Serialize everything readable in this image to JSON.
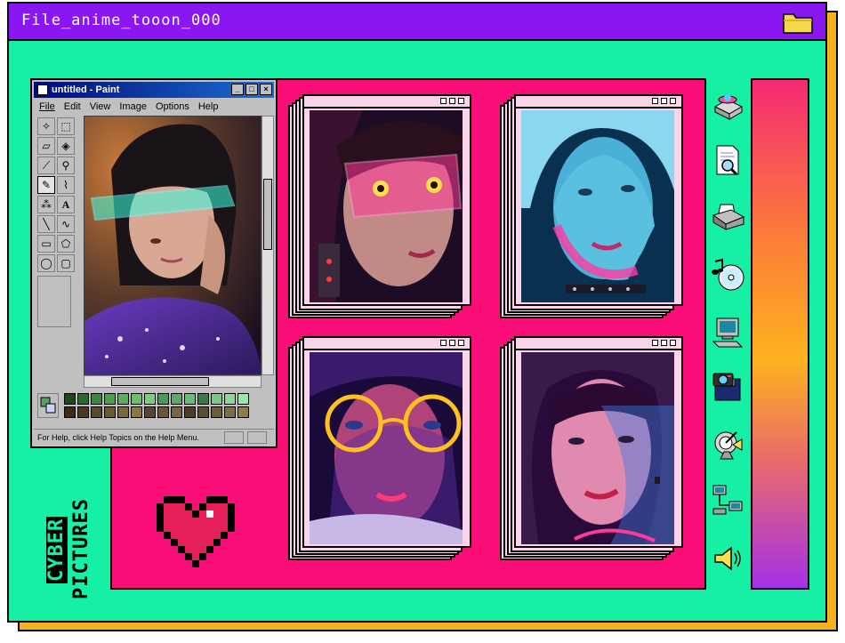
{
  "window": {
    "title": "File_anime_tooon_000",
    "folder_icon": "folder-icon"
  },
  "paint": {
    "title": "untitled - Paint",
    "min_label": "_",
    "max_label": "□",
    "close_label": "×",
    "menu": [
      "File",
      "Edit",
      "View",
      "Image",
      "Options",
      "Help"
    ],
    "tool_icons": [
      "free-select-icon",
      "rect-select-icon",
      "eraser-icon",
      "fill-icon",
      "eyedropper-icon",
      "magnifier-icon",
      "pencil-icon",
      "brush-icon",
      "airbrush-icon",
      "text-icon",
      "line-icon",
      "curve-icon",
      "rectangle-icon",
      "polygon-icon",
      "ellipse-icon",
      "rounded-rect-icon"
    ],
    "text_tool_label": "A",
    "status": "For Help, click Help Topics on the Help Menu.",
    "palette_row1": [
      "#1a4a1a",
      "#2a6a2a",
      "#3a8a3a",
      "#4aa04a",
      "#5ab05a",
      "#6ac06a",
      "#7ad07a",
      "#4a9a5a",
      "#5aaa6a",
      "#6aba7a",
      "#3a7a4a",
      "#7ac88a",
      "#8ad89a",
      "#9ae8aa"
    ],
    "palette_row2": [
      "#3a2a1a",
      "#4a3a22",
      "#5a4a2a",
      "#6a5a32",
      "#7a6a3a",
      "#8a7a42",
      "#5a4630",
      "#6a5638",
      "#7a6640",
      "#4a3e2a",
      "#5a4e32",
      "#6a5e3a",
      "#7a6e42",
      "#8a7e4a"
    ]
  },
  "photos": [
    {
      "name": "photo-cyber-visor-girl",
      "colors": [
        "#2a0a2a",
        "#ff2a8a",
        "#7a2a5a"
      ]
    },
    {
      "name": "photo-blue-hair-girl",
      "colors": [
        "#0a2a4a",
        "#3ad0ff",
        "#ff3aa0"
      ]
    },
    {
      "name": "photo-neon-glasses-girl",
      "colors": [
        "#1a0a3a",
        "#ff2aa0",
        "#ffb020"
      ]
    },
    {
      "name": "photo-bangs-girl",
      "colors": [
        "#2a0a3a",
        "#ff3a9a",
        "#3a9aff"
      ]
    }
  ],
  "right_icons": [
    "disk-drive-icon",
    "document-search-icon",
    "printer-icon",
    "music-cd-icon",
    "computer-icon",
    "camera-floppy-icon",
    "satellite-icon",
    "network-icon",
    "speaker-icon"
  ],
  "heart_icon": "pixel-heart-icon",
  "branding": {
    "line1": "CYBER",
    "line2": "PICTURES"
  },
  "colors": {
    "background": "#16f0a4",
    "titlebar": "#8a17f2",
    "panel": "#fa0f78",
    "card": "#fbd3ea",
    "shadow": "#f6b21e"
  }
}
